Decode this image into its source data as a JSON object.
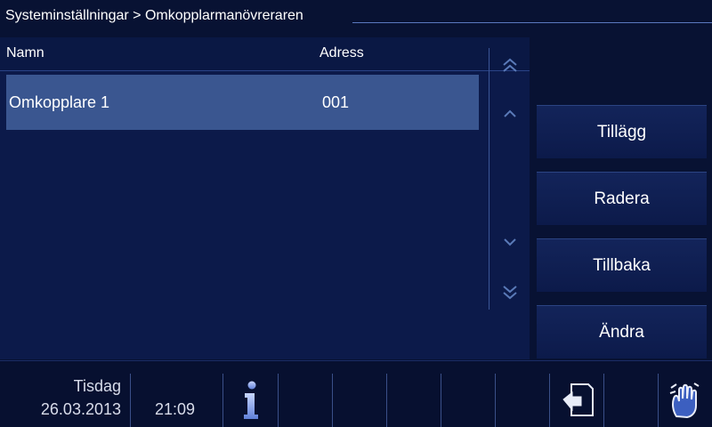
{
  "header": {
    "breadcrumb": "Systeminställningar > Omkopplarmanövreraren"
  },
  "list": {
    "columns": {
      "name": "Namn",
      "address": "Adress"
    },
    "rows": [
      {
        "name": "Omkopplare 1",
        "address": "001",
        "selected": true
      }
    ]
  },
  "scroll": {
    "icons": [
      "double-chevron-up-icon",
      "chevron-up-icon",
      "chevron-down-icon",
      "double-chevron-down-icon"
    ]
  },
  "actions": {
    "add_label": "Tillägg",
    "delete_label": "Radera",
    "back_label": "Tillbaka",
    "edit_label": "Ändra"
  },
  "status": {
    "day": "Tisdag",
    "date": "26.03.2013",
    "time": "21:09"
  },
  "footer_icons": [
    "info-icon",
    "return-icon",
    "clean-hand-icon"
  ],
  "colors": {
    "background": "#081233",
    "panel": "#0c1a4a",
    "selected_row": "#3a5690",
    "accent_line": "#5a78c0"
  }
}
